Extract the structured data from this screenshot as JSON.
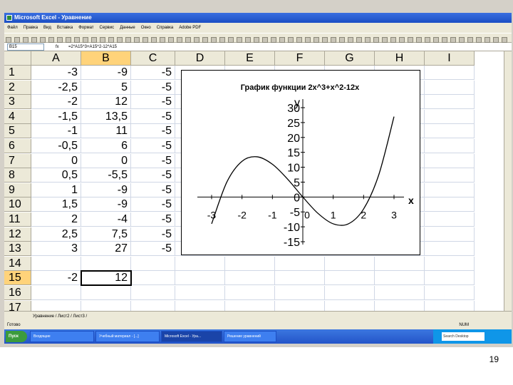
{
  "window": {
    "title": "Microsoft Excel - Уравнение"
  },
  "menu": [
    "Файл",
    "Правка",
    "Вид",
    "Вставка",
    "Формат",
    "Сервис",
    "Данные",
    "Окно",
    "Справка",
    "Adobe PDF"
  ],
  "formula_bar": {
    "name_box": "B15",
    "fx": "fx",
    "formula": "=2*A15^3+A15^2-12*A15"
  },
  "columns": [
    "A",
    "B",
    "C",
    "D",
    "E",
    "F",
    "G",
    "H",
    "I"
  ],
  "rows": [
    {
      "n": "1",
      "a": "-3",
      "b": "-9",
      "c": "-5"
    },
    {
      "n": "2",
      "a": "-2,5",
      "b": "5",
      "c": "-5"
    },
    {
      "n": "3",
      "a": "-2",
      "b": "12",
      "c": "-5"
    },
    {
      "n": "4",
      "a": "-1,5",
      "b": "13,5",
      "c": "-5"
    },
    {
      "n": "5",
      "a": "-1",
      "b": "11",
      "c": "-5"
    },
    {
      "n": "6",
      "a": "-0,5",
      "b": "6",
      "c": "-5"
    },
    {
      "n": "7",
      "a": "0",
      "b": "0",
      "c": "-5"
    },
    {
      "n": "8",
      "a": "0,5",
      "b": "-5,5",
      "c": "-5"
    },
    {
      "n": "9",
      "a": "1",
      "b": "-9",
      "c": "-5"
    },
    {
      "n": "10",
      "a": "1,5",
      "b": "-9",
      "c": "-5"
    },
    {
      "n": "11",
      "a": "2",
      "b": "-4",
      "c": "-5"
    },
    {
      "n": "12",
      "a": "2,5",
      "b": "7,5",
      "c": "-5"
    },
    {
      "n": "13",
      "a": "3",
      "b": "27",
      "c": "-5"
    },
    {
      "n": "14",
      "a": "",
      "b": "",
      "c": ""
    },
    {
      "n": "15",
      "a": "-2",
      "b": "12",
      "c": ""
    },
    {
      "n": "16",
      "a": "",
      "b": "",
      "c": ""
    },
    {
      "n": "17",
      "a": "",
      "b": "",
      "c": ""
    }
  ],
  "chart_data": {
    "type": "line",
    "title": "График функции 2x^3+x^2-12x",
    "xlabel": "x",
    "ylabel": "y",
    "x": [
      -3,
      -2.5,
      -2,
      -1.5,
      -1,
      -0.5,
      0,
      0.5,
      1,
      1.5,
      2,
      2.5,
      3
    ],
    "series": [
      {
        "values": [
          -9,
          5,
          12,
          13.5,
          11,
          6,
          0,
          -5.5,
          -9,
          -9,
          -4,
          7.5,
          27
        ]
      }
    ],
    "xticks": [
      "-3",
      "-2",
      "-1",
      "0",
      "1",
      "2",
      "3"
    ],
    "yticks": [
      "30",
      "25",
      "20",
      "15",
      "10",
      "5",
      "0",
      "-5",
      "-10",
      "-15"
    ],
    "xlim": [
      -3,
      3
    ],
    "ylim": [
      -15,
      30
    ],
    "grid": false,
    "legend": "none"
  },
  "sheet_tabs": "Уравнение / Лист2 / Лист3 /",
  "status": {
    "left": "Готово",
    "num": "NUM"
  },
  "taskbar": {
    "start": "Пуск",
    "tasks": [
      "Входящие",
      "Учебный материал - [...]",
      "Microsoft Excel - Ура...",
      "Решение уравнений"
    ],
    "search": "Search Desktop"
  },
  "page_number": "19",
  "colors": {
    "title_bar": "#1c4fc4",
    "selected_header": "#ffd37a",
    "taskbar": "#2454c8"
  }
}
